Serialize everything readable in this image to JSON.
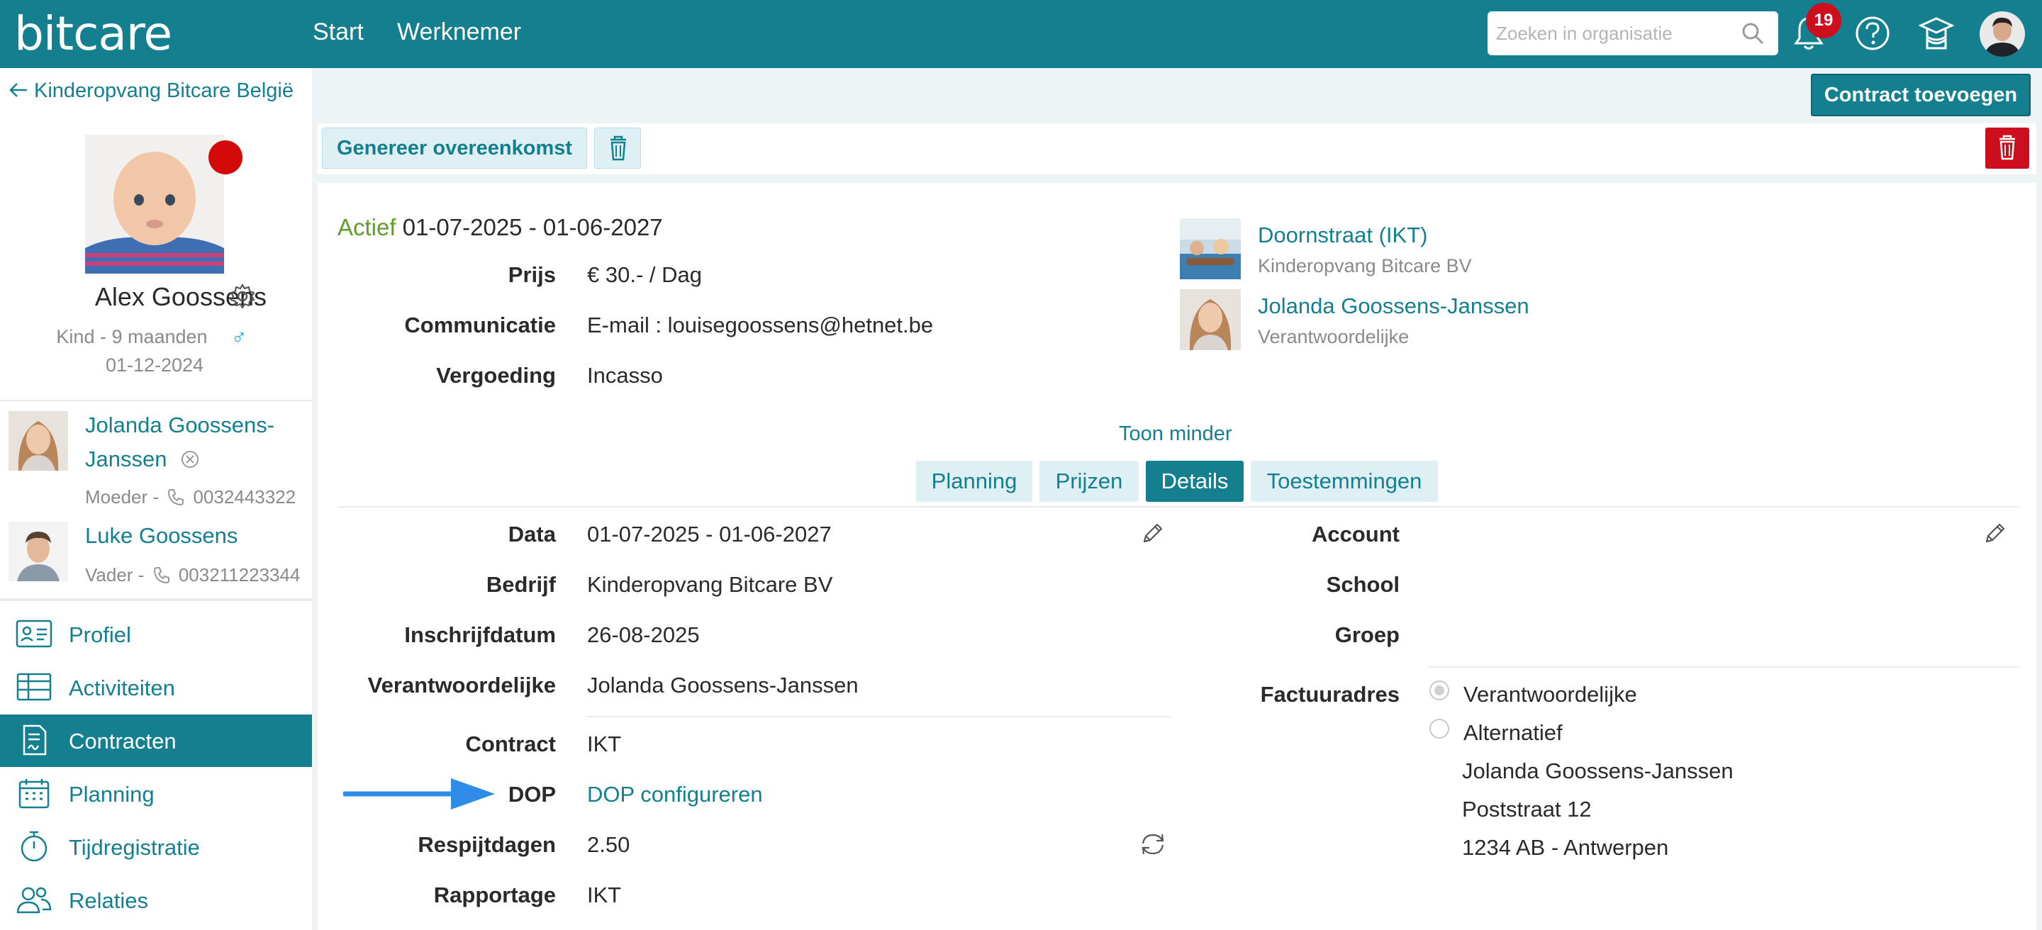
{
  "topbar": {
    "logo": "bitcare",
    "nav": [
      "Start",
      "Werknemer"
    ],
    "search_placeholder": "Zoeken in organisatie",
    "notification_count": "19"
  },
  "sidebar": {
    "back_label": "Kinderopvang Bitcare België",
    "child": {
      "name": "Alex Goossens",
      "type_age": "Kind - 9 maanden",
      "birthdate": "01-12-2024",
      "gender_symbol": "♂"
    },
    "parents": [
      {
        "name_line1": "Jolanda Goossens-",
        "name_line2": "Janssen",
        "role": "Moeder -",
        "phone": "0032443322"
      },
      {
        "name": "Luke Goossens",
        "role": "Vader -",
        "phone": "003211223344"
      }
    ],
    "menu": [
      {
        "label": "Profiel",
        "icon": "profile-card-icon"
      },
      {
        "label": "Activiteiten",
        "icon": "table-icon"
      },
      {
        "label": "Contracten",
        "icon": "contract-icon",
        "active": true
      },
      {
        "label": "Planning",
        "icon": "calendar-icon"
      },
      {
        "label": "Tijdregistratie",
        "icon": "stopwatch-icon"
      },
      {
        "label": "Relaties",
        "icon": "people-icon"
      }
    ]
  },
  "actions": {
    "add_contract": "Contract toevoegen",
    "generate_agreement": "Genereer overeenkomst"
  },
  "contract": {
    "status": "Actief",
    "period": "01-07-2025 - 01-06-2027",
    "summary": [
      {
        "label": "Prijs",
        "value": "€ 30.- / Dag"
      },
      {
        "label": "Communicatie",
        "value": "E-mail : louisegoossens@hetnet.be"
      },
      {
        "label": "Vergoeding",
        "value": "Incasso"
      }
    ],
    "location": {
      "name": "Doornstraat (IKT)",
      "org": "Kinderopvang Bitcare BV"
    },
    "responsible": {
      "name": "Jolanda Goossens-Janssen",
      "role": "Verantwoordelijke"
    },
    "toggle_label": "Toon minder",
    "tabs": [
      "Planning",
      "Prijzen",
      "Details",
      "Toestemmingen"
    ],
    "active_tab": "Details",
    "details_left": [
      {
        "label": "Data",
        "value": "01-07-2025 - 01-06-2027"
      },
      {
        "label": "Bedrijf",
        "value": "Kinderopvang Bitcare BV"
      },
      {
        "label": "Inschrijfdatum",
        "value": "26-08-2025"
      },
      {
        "label": "Verantwoordelijke",
        "value": "Jolanda Goossens-Janssen"
      },
      {
        "label": "Contract",
        "value": "IKT"
      },
      {
        "label": "DOP",
        "value": "DOP configureren"
      },
      {
        "label": "Respijtdagen",
        "value": "2.50"
      },
      {
        "label": "Rapportage",
        "value": "IKT"
      }
    ],
    "details_right": [
      {
        "label": "Account",
        "value": ""
      },
      {
        "label": "School",
        "value": ""
      },
      {
        "label": "Groep",
        "value": ""
      }
    ],
    "invoice": {
      "label": "Factuuradres",
      "options": [
        "Verantwoordelijke",
        "Alternatief"
      ],
      "selected": "Verantwoordelijke",
      "address": [
        "Jolanda Goossens-Janssen",
        "Poststraat 12",
        "1234 AB - Antwerpen"
      ]
    }
  },
  "colors": {
    "primary": "#137f8f",
    "danger": "#cc0e1d",
    "active_status": "#5f9e2a",
    "annotation_arrow": "#2f8be8"
  }
}
